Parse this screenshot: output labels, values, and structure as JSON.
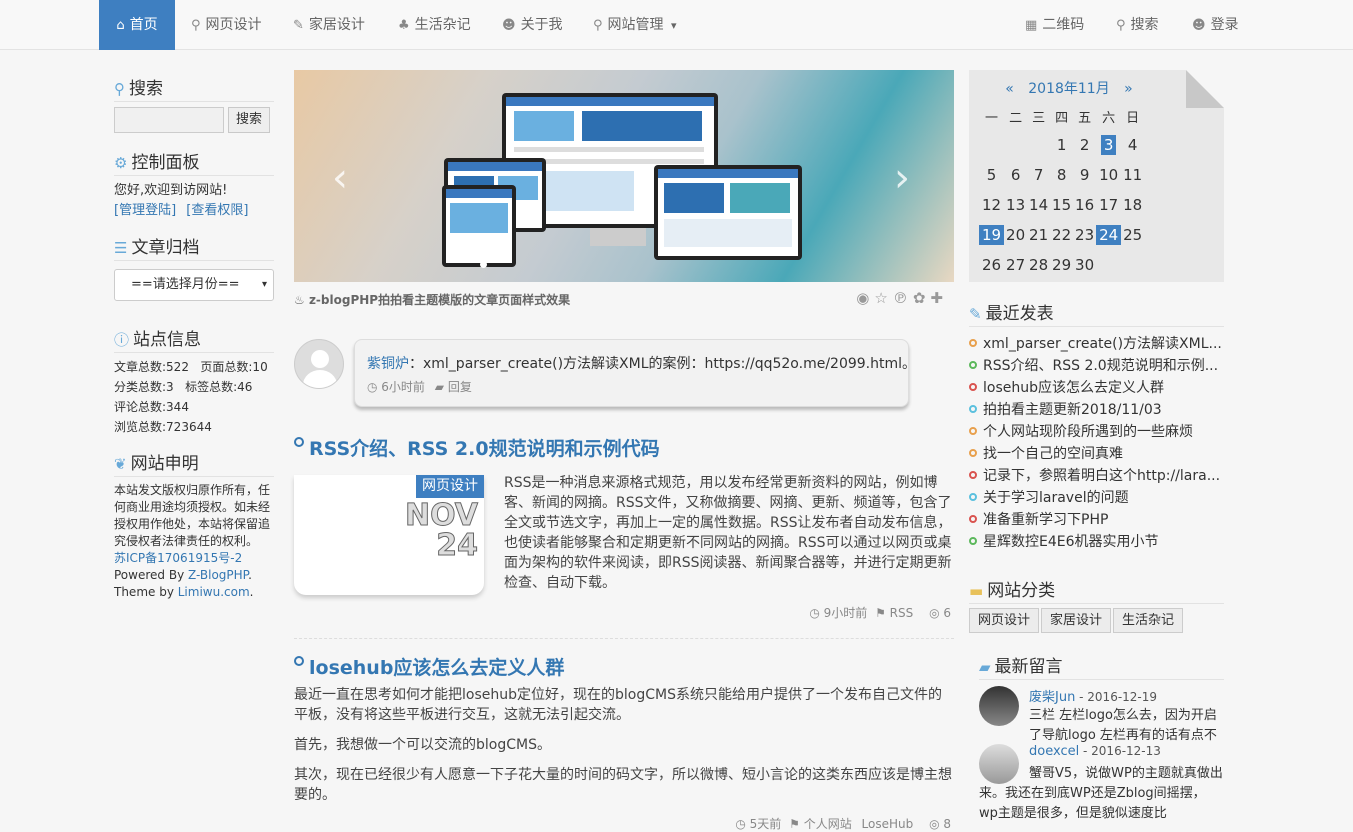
{
  "nav": {
    "items": [
      {
        "label": "首页",
        "icon": "home-icon",
        "glyph": "⌂",
        "active": true
      },
      {
        "label": "网页设计",
        "icon": "location-pin-icon",
        "glyph": "⚲"
      },
      {
        "label": "家居设计",
        "icon": "leaf-icon",
        "glyph": "✎"
      },
      {
        "label": "生活杂记",
        "icon": "tree-icon",
        "glyph": "♣"
      },
      {
        "label": "关于我",
        "icon": "user-icon",
        "glyph": "☻"
      },
      {
        "label": "网站管理",
        "icon": "location-pin-icon",
        "glyph": "⚲",
        "caret": "▾"
      }
    ],
    "right": [
      {
        "label": "二维码",
        "icon": "qrcode-icon",
        "glyph": "▦"
      },
      {
        "label": "搜索",
        "icon": "search-icon",
        "glyph": "⚲"
      },
      {
        "label": "登录",
        "icon": "user-icon",
        "glyph": "☻"
      }
    ]
  },
  "sidebar": {
    "search": {
      "title": "搜索",
      "button": "搜索",
      "value": ""
    },
    "control": {
      "title": "控制面板",
      "welcome": "您好,欢迎到访网站!",
      "link1": "[管理登陆]",
      "link2": "[查看权限]"
    },
    "archive": {
      "title": "文章归档",
      "select": "==请选择月份=="
    },
    "stats": {
      "title": "站点信息",
      "line1": "文章总数:522   页面总数:10",
      "line2": "分类总数:3   标签总数:46",
      "line3": "评论总数:344",
      "line4": "浏览总数:723644"
    },
    "notice": {
      "title": "网站申明",
      "text": "本站发文版权归原作所有，任何商业用途均须授权。如未经授权用作他处，本站将保留追究侵权者法律责任的权利。",
      "icp": "苏ICP备17061915号-2",
      "powered_prefix": "Powered By ",
      "powered_link": "Z-BlogPHP",
      "powered_suffix": ".",
      "theme_prefix": "Theme by ",
      "theme_link": "Limiwu.com",
      "theme_suffix": "."
    }
  },
  "slider": {
    "caption": "z-blogPHP拍拍看主题模版的文章页面样式效果",
    "prev": "‹",
    "next": "›"
  },
  "share": {
    "icons": [
      "weibo-icon",
      "qzone-icon",
      "pinterest-icon",
      "baidu-icon",
      "plus-icon"
    ],
    "glyphs": [
      "◉",
      "☆",
      "℗",
      "✿",
      "✚"
    ]
  },
  "comment_box": {
    "author": "紫铜炉",
    "text": "：xml_parser_create()方法解读XML的案例：https://qq52o.me/2099.html。",
    "time": "6小时前",
    "reply": "回复"
  },
  "posts": [
    {
      "title": "RSS介绍、RSS 2.0规范说明和示例代码",
      "category": "网页设计",
      "month": "NOV",
      "day": "24",
      "excerpt": "RSS是一种消息来源格式规范，用以发布经常更新资料的网站，例如博客、新闻的网摘。RSS文件，又称做摘要、网摘、更新、频道等，包含了全文或节选文字，再加上一定的属性数据。RSS让发布者自动发布信息，也使读者能够聚合和定期更新不同网站的网摘。RSS可以通过以网页或桌面为架构的软件来阅读，即RSS阅读器、新闻聚合器等，并进行定期更新检查、自动下载。",
      "time": "9小时前",
      "tags": "RSS",
      "views": "6"
    },
    {
      "title": "losehub应该怎么去定义人群",
      "para1": "最近一直在思考如何才能把losehub定位好，现在的blogCMS系统只能给用户提供了一个发布自己文件的平板，没有将这些平板进行交互，这就无法引起交流。",
      "para2": "首先，我想做一个可以交流的blogCMS。",
      "para3": "其次，现在已经很少有人愿意一下子花大量的时间的码文字，所以微博、短小言论的这类东西应该是博主想要的。",
      "time": "5天前",
      "tag1": "个人网站",
      "tag2": "LoseHub",
      "views": "8"
    }
  ],
  "calendar": {
    "title": "2018年11月",
    "prev": "«",
    "next": "»",
    "weekdays": [
      "一",
      "二",
      "三",
      "四",
      "五",
      "六",
      "日"
    ],
    "weeks": [
      [
        "",
        "",
        "",
        "1",
        "2",
        "3",
        "4"
      ],
      [
        "5",
        "6",
        "7",
        "8",
        "9",
        "10",
        "11"
      ],
      [
        "12",
        "13",
        "14",
        "15",
        "16",
        "17",
        "18"
      ],
      [
        "19",
        "20",
        "21",
        "22",
        "23",
        "24",
        "25"
      ],
      [
        "26",
        "27",
        "28",
        "29",
        "30",
        "",
        ""
      ]
    ],
    "highlight": [
      "3",
      "19",
      "24"
    ]
  },
  "recent": {
    "title": "最近发表",
    "items": [
      "xml_parser_create()方法解读XML...",
      "RSS介绍、RSS 2.0规范说明和示例...",
      "losehub应该怎么去定义人群",
      "拍拍看主题更新2018/11/03",
      "个人网站现阶段所遇到的一些麻烦",
      "找一个自己的空间真难",
      "记录下，参照着明白这个http://lara...",
      "关于学习laravel的问题",
      "准备重新学习下PHP",
      "星辉数控E4E6机器实用小节"
    ],
    "colors": [
      "#e8a04d",
      "#5cb85c",
      "#d9534f",
      "#5bc0de",
      "#e8a04d",
      "#e8a04d",
      "#d9534f",
      "#5bc0de",
      "#d9534f",
      "#5cb85c"
    ]
  },
  "categories": {
    "title": "网站分类",
    "items": [
      "网页设计",
      "家居设计",
      "生活杂记"
    ]
  },
  "messages": {
    "title": "最新留言",
    "items": [
      {
        "author": "废柴Jun",
        "date": " - 2016-12-19",
        "text": "三栏 左栏logo怎么去，因为开启了导航logo 左栏再有的话有点不适"
      },
      {
        "author": "doexcel",
        "date": " - 2016-12-13",
        "text": "蟹哥V5，说做WP的主题就真做出来。我还在到底WP还是Zblog间摇摆，wp主题是很多，但是貌似速度比"
      }
    ]
  },
  "colors": {
    "accent": "#3e7fc1",
    "link": "#3477b2"
  }
}
